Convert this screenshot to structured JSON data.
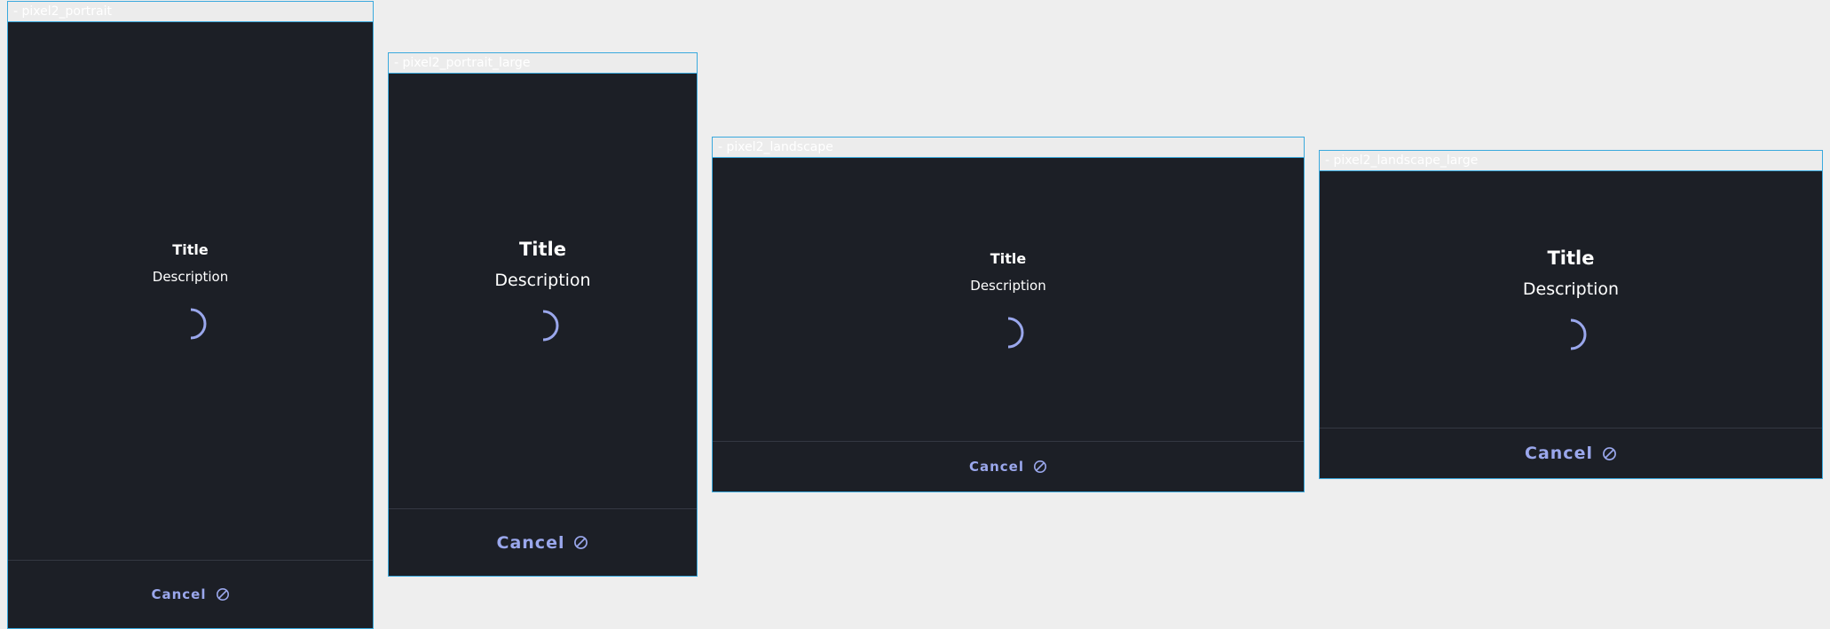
{
  "colors": {
    "background": "#eeeeee",
    "frame_border": "#3aa9dd",
    "surface": "#1c1f26",
    "text": "#ffffff",
    "accent": "#9aa7ec",
    "divider": "#343842"
  },
  "frames": [
    {
      "label": "- pixel2_portrait",
      "title": "Title",
      "description": "Description",
      "cancel_label": "Cancel",
      "cancel_icon": "ban-icon"
    },
    {
      "label": "- pixel2_portrait_large",
      "title": "Title",
      "description": "Description",
      "cancel_label": "Cancel",
      "cancel_icon": "ban-icon"
    },
    {
      "label": "- pixel2_landscape",
      "title": "Title",
      "description": "Description",
      "cancel_label": "Cancel",
      "cancel_icon": "ban-icon"
    },
    {
      "label": "- pixel2_landscape_large",
      "title": "Title",
      "description": "Description",
      "cancel_label": "Cancel",
      "cancel_icon": "ban-icon"
    }
  ]
}
